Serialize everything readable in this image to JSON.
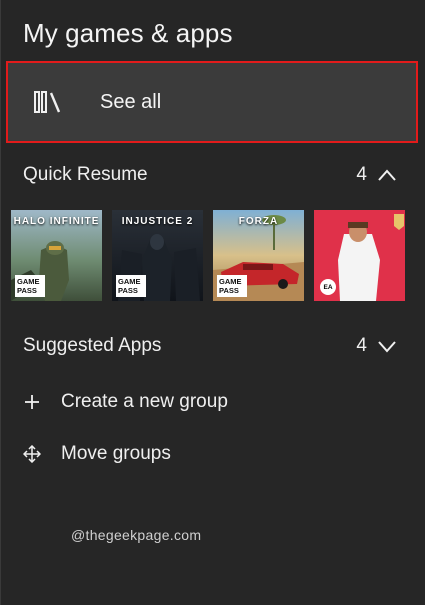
{
  "header": {
    "title": "My games & apps"
  },
  "see_all": {
    "label": "See all",
    "icon": "library-icon"
  },
  "quick_resume": {
    "title": "Quick Resume",
    "count": "4",
    "expanded": true,
    "tiles": [
      {
        "name": "HALO INFINITE",
        "badge": "GAME PASS"
      },
      {
        "name": "INJUSTICE 2",
        "badge": "GAME PASS"
      },
      {
        "name": "FORZA",
        "badge": "GAME PASS"
      },
      {
        "name": "",
        "badge": "EA"
      }
    ]
  },
  "suggested_apps": {
    "title": "Suggested Apps",
    "count": "4",
    "expanded": false
  },
  "actions": {
    "create_group": "Create a new group",
    "move_groups": "Move groups"
  },
  "watermark": "@thegeekpage.com",
  "colors": {
    "panel_bg": "#262626",
    "highlight_bg": "#3b3b3b",
    "focus_border": "#e21b1b",
    "text": "#efefef"
  }
}
